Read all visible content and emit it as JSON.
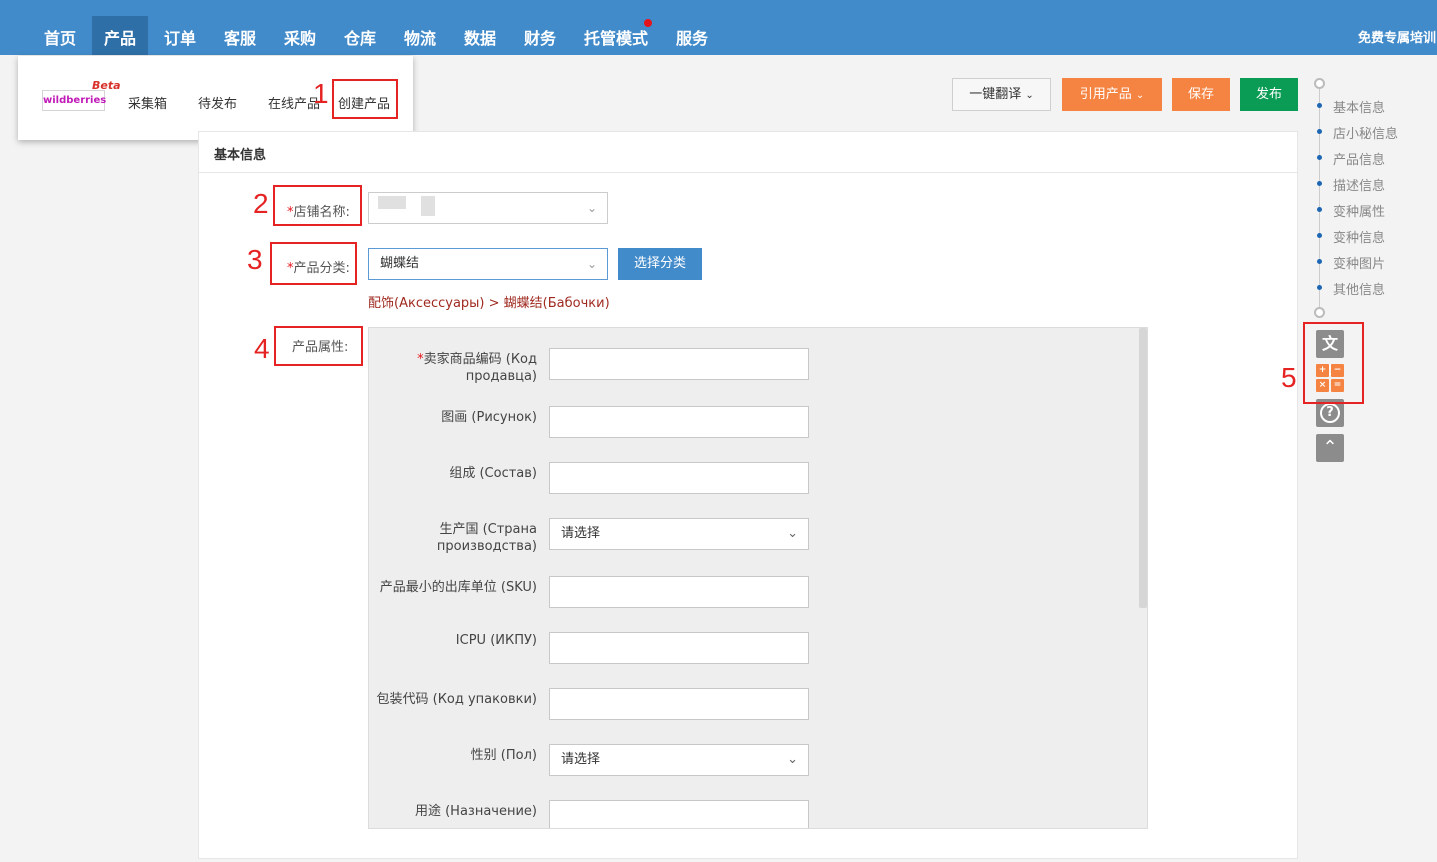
{
  "top_nav": {
    "items": [
      "首页",
      "产品",
      "订单",
      "客服",
      "采购",
      "仓库",
      "物流",
      "数据",
      "财务",
      "托管模式",
      "服务"
    ],
    "active_item": "产品",
    "right_link": "免费专属培训"
  },
  "product_menu": {
    "brand_logo": "wildberries",
    "beta_badge": "Beta",
    "items": [
      "采集箱",
      "待发布",
      "在线产品",
      "创建产品"
    ]
  },
  "toolbar": {
    "translate_label": "一键翻译",
    "cite_label": "引用产品",
    "save_label": "保存",
    "publish_label": "发布"
  },
  "section_title": "基本信息",
  "form": {
    "store_name_label": "店铺名称:",
    "store_name_value": "",
    "category_label": "产品分类:",
    "category_value": "蝴蝶结",
    "select_category_button": "选择分类",
    "category_path": "配饰(Аксессуары) > 蝴蝶结(Бабочки)",
    "attributes_label": "产品属性:",
    "required_mark": "*"
  },
  "attributes": [
    {
      "label_line1": "卖家商品编码 (Код",
      "label_line2": "продавца)",
      "required": true,
      "type": "text",
      "value": ""
    },
    {
      "label_line1": "图画 (Рисунок)",
      "label_line2": "",
      "required": false,
      "type": "text",
      "value": ""
    },
    {
      "label_line1": "组成 (Состав)",
      "label_line2": "",
      "required": false,
      "type": "text",
      "value": ""
    },
    {
      "label_line1": "生产国 (Страна",
      "label_line2": "производства)",
      "required": false,
      "type": "select",
      "value": "请选择"
    },
    {
      "label_line1": "产品最小的出库单位 (SKU)",
      "label_line2": "",
      "required": false,
      "type": "text",
      "value": ""
    },
    {
      "label_line1": "ICPU (ИКПУ)",
      "label_line2": "",
      "required": false,
      "type": "text",
      "value": ""
    },
    {
      "label_line1": "包装代码 (Код упаковки)",
      "label_line2": "",
      "required": false,
      "type": "text",
      "value": ""
    },
    {
      "label_line1": "性别 (Пол)",
      "label_line2": "",
      "required": false,
      "type": "select",
      "value": "请选择"
    },
    {
      "label_line1": "用途 (Назначение)",
      "label_line2": "",
      "required": false,
      "type": "text",
      "value": ""
    }
  ],
  "right_nav": {
    "items": [
      "基本信息",
      "店小秘信息",
      "产品信息",
      "描述信息",
      "变种属性",
      "变种信息",
      "变种图片",
      "其他信息"
    ]
  },
  "tools": {
    "translate_icon": "translate-icon",
    "calculator_icon": "calculator-icon",
    "help_icon": "help-icon",
    "back_to_top_icon": "back-to-top-icon"
  },
  "annotations": [
    "1",
    "2",
    "3",
    "4",
    "5"
  ],
  "colors": {
    "nav_bg": "#428bca",
    "nav_active": "#2f6fa7",
    "orange": "#f58341",
    "green": "#0a9b54",
    "annotation_red": "#e52323",
    "category_path": "#a02a20"
  }
}
